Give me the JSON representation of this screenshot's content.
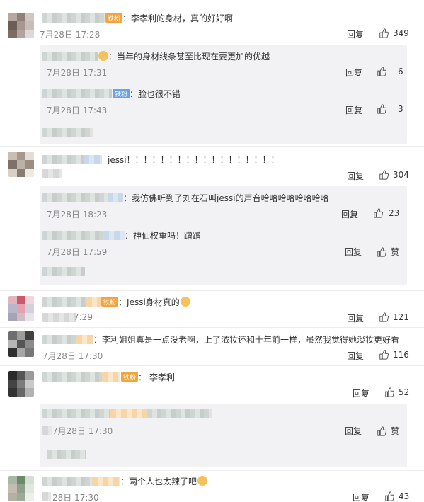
{
  "comments": [
    {
      "text": "李孝利的身材，真的好好啊",
      "badge": "铁粉",
      "time": "7月28日 17:28",
      "reply": "回复",
      "likes": "349",
      "subs": [
        {
          "text": "当年的身材线条甚至比现在要更加的优越",
          "time": "7月28日 17:31",
          "reply": "回复",
          "likes": "6"
        },
        {
          "text": "脸也很不错",
          "badge": "铁粉",
          "time": "7月28日 17:43",
          "reply": "回复",
          "likes": "3"
        }
      ]
    },
    {
      "text": "jessi！！！！！！！！！！！！！！！！！！",
      "reply": "回复",
      "likes": "304",
      "subs": [
        {
          "text": "我仿佛听到了刘在石叫jessi的声音哈哈哈哈哈哈哈哈",
          "time": "7月28日 18:23",
          "reply": "回复",
          "likes": "23"
        },
        {
          "text": "神仙权重吗！蹭蹭",
          "time": "7月28日 17:59",
          "reply": "回复",
          "likes": "赞"
        }
      ]
    },
    {
      "text": "Jessi身材真的",
      "badge": "铁粉",
      "time": "7:29",
      "reply": "回复",
      "likes": "121"
    },
    {
      "text": "李利姐姐真是一点没老啊，上了浓妆还和十年前一样，虽然我觉得她淡妆更好看",
      "time": "7月28日 17:30",
      "reply": "回复",
      "likes": "116"
    },
    {
      "text": "李孝利",
      "badge": "铁粉",
      "reply": "回复",
      "likes": "52",
      "subs": [
        {
          "time": "7月28日 17:30",
          "reply": "回复",
          "likes": "赞"
        }
      ]
    },
    {
      "text": "两个人也太辣了吧",
      "time": "28日 17:30",
      "reply": "回复",
      "likes": "43"
    }
  ]
}
